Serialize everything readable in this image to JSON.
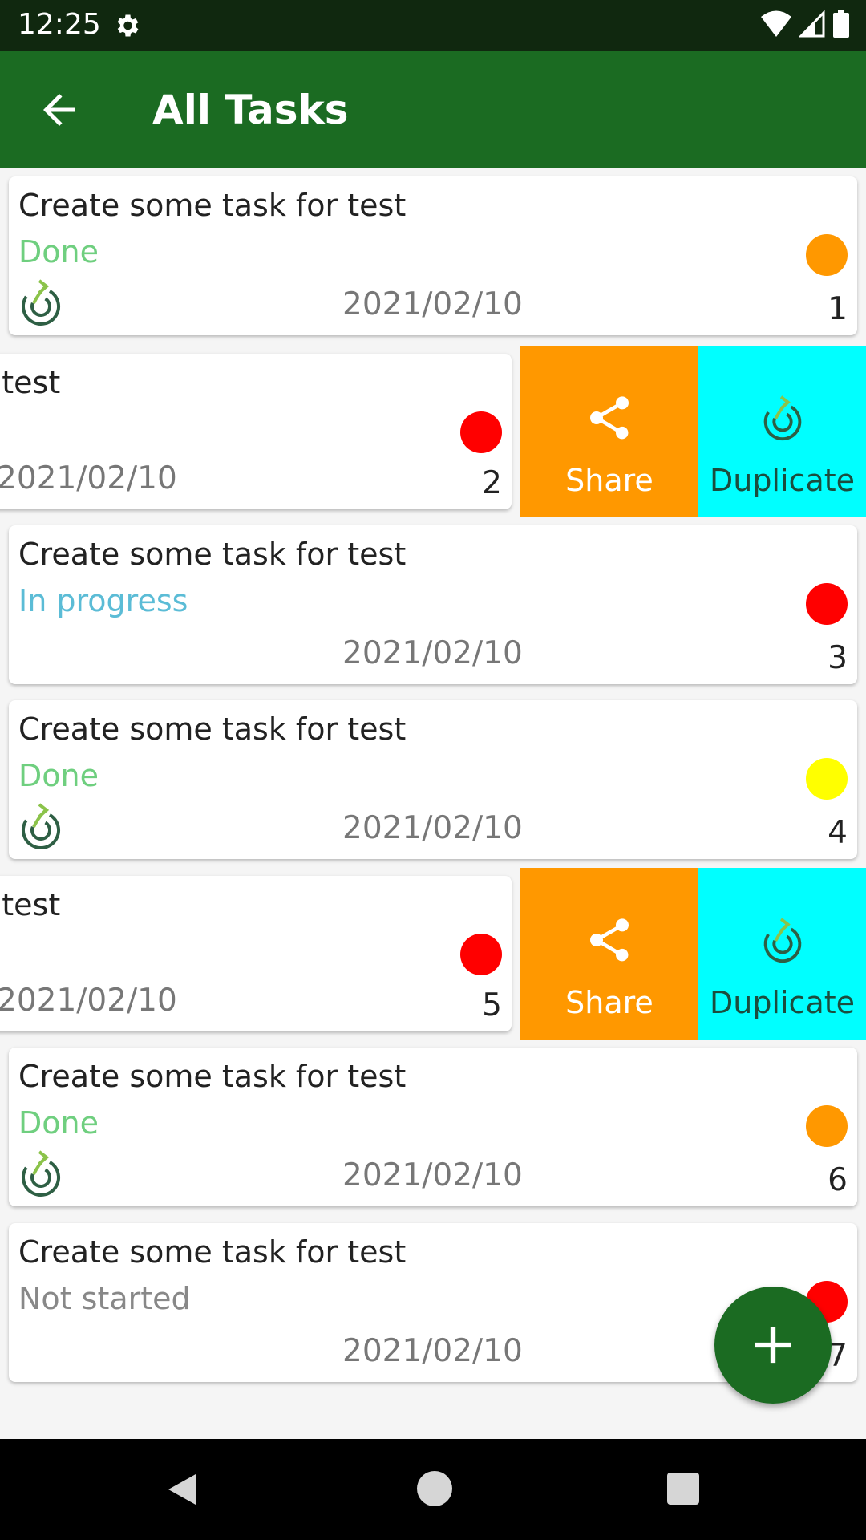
{
  "status_bar": {
    "time": "12:25"
  },
  "app_bar": {
    "title": "All Tasks"
  },
  "colors": {
    "app_bar": "#1b6b22",
    "status_done": "#6fcf7f",
    "status_in_progress": "#5bbcd6",
    "status_not_started": "#888888",
    "priority_orange": "#ff9800",
    "priority_red": "#ff0000",
    "priority_yellow": "#ffff00",
    "share_action": "#ff9800",
    "duplicate_action": "#00ffff"
  },
  "swipe_actions": {
    "share_label": "Share",
    "duplicate_label": "Duplicate"
  },
  "tasks": [
    {
      "title": "Create some task for test",
      "status": "Done",
      "date": "2021/02/10",
      "number": "1",
      "priority": "orange",
      "has_duplicate_icon": true,
      "swiped": false
    },
    {
      "title": "Create some task for test",
      "title_visible": "test",
      "status": "",
      "date": "2021/02/10",
      "number": "2",
      "priority": "red",
      "has_duplicate_icon": false,
      "swiped": true
    },
    {
      "title": "Create some task for test",
      "status": "In progress",
      "date": "2021/02/10",
      "number": "3",
      "priority": "red",
      "has_duplicate_icon": false,
      "swiped": false
    },
    {
      "title": "Create some task for test",
      "status": "Done",
      "date": "2021/02/10",
      "number": "4",
      "priority": "yellow",
      "has_duplicate_icon": true,
      "swiped": false
    },
    {
      "title": "Create some task for test",
      "title_visible": "test",
      "status": "",
      "date": "2021/02/10",
      "number": "5",
      "priority": "red",
      "has_duplicate_icon": false,
      "swiped": true
    },
    {
      "title": "Create some task for test",
      "status": "Done",
      "date": "2021/02/10",
      "number": "6",
      "priority": "orange",
      "has_duplicate_icon": true,
      "swiped": false
    },
    {
      "title": "Create some task for test",
      "status": "Not started",
      "date": "2021/02/10",
      "number": "7",
      "priority": "red",
      "has_duplicate_icon": false,
      "swiped": false
    }
  ]
}
